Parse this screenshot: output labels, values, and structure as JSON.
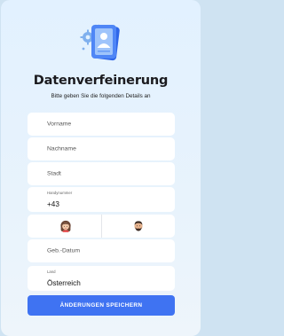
{
  "form": {
    "title": "Datenverfeinerung",
    "subtitle": "Bitte geben Sie die folgenden Details an",
    "first_name_placeholder": "Vorname",
    "last_name_placeholder": "Nachname",
    "city_placeholder": "Stadt",
    "phone_label": "Handynummer",
    "phone_value": "+43",
    "birthdate_placeholder": "Geb.-Datum",
    "country_label": "Land",
    "country_value": "Österreich",
    "save_label": "ÄNDERUNGEN SPEICHERN"
  },
  "icons": {
    "hero": "profile-card-gear-icon",
    "female": "female-avatar-icon",
    "male": "male-avatar-icon"
  },
  "colors": {
    "accent": "#3f73f2",
    "background": "#e2f1ff",
    "field": "#ffffff"
  }
}
